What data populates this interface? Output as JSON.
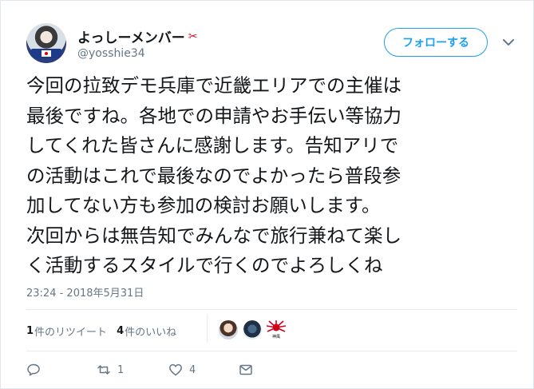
{
  "user": {
    "display_name": "よっしーメンバー",
    "name_emoji": "✂",
    "handle": "@yosshie34",
    "follow_label": "フォローする"
  },
  "tweet": {
    "lines": [
      "今回の拉致デモ兵庫で近畿エリアでの主催は",
      "最後ですね。各地での申請やお手伝い等協力",
      "してくれた皆さんに感謝します。告知アリで",
      "の活動はこれで最後なのでよかったら普段参",
      "加してない方も参加の検討お願いします。",
      "次回からは無告知でみんなで旅行兼ねて楽し",
      "く活動するスタイルで行くのでよろしくね"
    ],
    "timestamp": "23:24 - 2018年5月31日"
  },
  "stats": {
    "retweets_count": "1",
    "retweets_label": "件のリツイート",
    "likes_count": "4",
    "likes_label": "件のいいね"
  },
  "liker_3_label": "神風",
  "actions": {
    "retweet_count": "1",
    "like_count": "4"
  },
  "colors": {
    "accent": "#1da1f2",
    "secondary_text": "#657786",
    "divider": "#e6ecf0"
  },
  "icons": [
    "avatar",
    "scissors-icon",
    "chevron-down-icon",
    "reply-icon",
    "retweet-icon",
    "heart-icon",
    "message-icon"
  ]
}
